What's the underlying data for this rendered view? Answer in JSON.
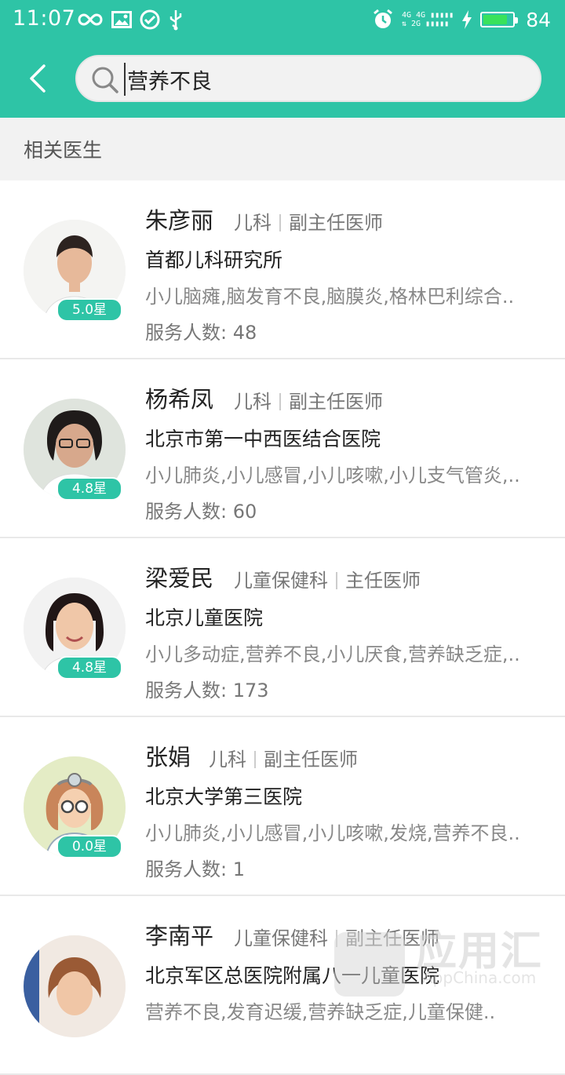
{
  "status": {
    "time": "11:07",
    "battery": "84",
    "battery_level": 0.84
  },
  "search": {
    "value": "营养不良",
    "placeholder": ""
  },
  "section": {
    "title": "相关医生"
  },
  "doctors": [
    {
      "name": "朱彦丽",
      "dept": "儿科",
      "title": "副主任医师",
      "hospital": "首都儿科研究所",
      "skill": "小儿脑瘫,脑发育不良,脑膜炎,格林巴利综合..",
      "served": "服务人数: 48",
      "rating": "5.0星"
    },
    {
      "name": "杨希凤",
      "dept": "儿科",
      "title": "副主任医师",
      "hospital": "北京市第一中西医结合医院",
      "skill": "小儿肺炎,小儿感冒,小儿咳嗽,小儿支气管炎,..",
      "served": "服务人数: 60",
      "rating": "4.8星"
    },
    {
      "name": "梁爱民",
      "dept": "儿童保健科",
      "title": "主任医师",
      "hospital": "北京儿童医院",
      "skill": "小儿多动症,营养不良,小儿厌食,营养缺乏症,..",
      "served": "服务人数: 173",
      "rating": "4.8星"
    },
    {
      "name": "张娟",
      "dept": "儿科",
      "title": "副主任医师",
      "hospital": "北京大学第三医院",
      "skill": "小儿肺炎,小儿感冒,小儿咳嗽,发烧,营养不良..",
      "served": "服务人数: 1",
      "rating": "0.0星"
    },
    {
      "name": "李南平",
      "dept": "儿童保健科",
      "title": "副主任医师",
      "hospital": "北京军区总医院附属八一儿童医院",
      "skill": "营养不良,发育迟缓,营养缺乏症,儿童保健..",
      "served": "",
      "rating": ""
    }
  ],
  "watermark": {
    "brand": "应用汇",
    "url": "AppChina.com"
  }
}
